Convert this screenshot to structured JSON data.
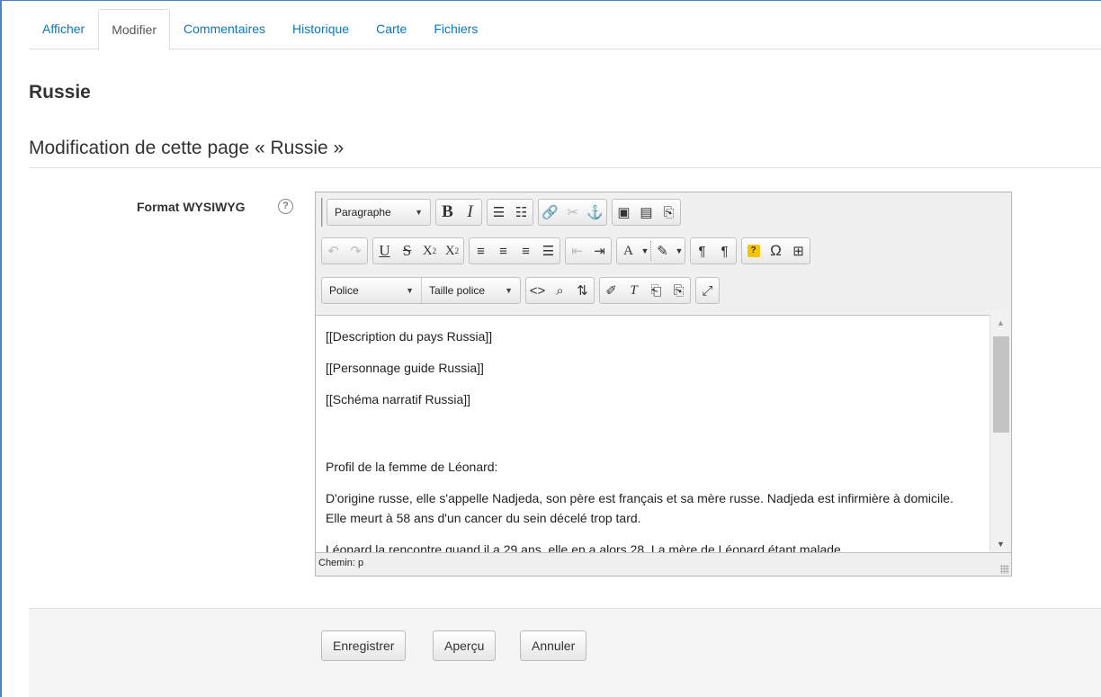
{
  "tabs": [
    {
      "label": "Afficher"
    },
    {
      "label": "Modifier",
      "active": true
    },
    {
      "label": "Commentaires"
    },
    {
      "label": "Historique"
    },
    {
      "label": "Carte"
    },
    {
      "label": "Fichiers"
    }
  ],
  "page_title": "Russie",
  "section_title": "Modification de cette page « Russie »",
  "field_label": "Format WYSIWYG",
  "help_icon_glyph": "?",
  "editor": {
    "paragraph_format": "Paragraphe",
    "font_family": "Police",
    "font_size": "Taille police",
    "content": [
      "[[Description du pays Russia]]",
      "[[Personnage guide Russia]]",
      "[[Schéma narratif Russia]]",
      "Profil de la femme de Léonard:",
      "D'origine russe, elle s'appelle Nadjeda, son père est français et sa mère russe. Nadjeda est infirmière à domicile. Elle meurt à 58 ans d'un cancer du sein décelé trop tard.",
      "Léonard la rencontre quand il a 29 ans, elle en a alors 28. La mère de Léonard étant malade"
    ],
    "status_path": "Chemin: p"
  },
  "buttons": {
    "save": "Enregistrer",
    "preview": "Aperçu",
    "cancel": "Annuler"
  },
  "colors": {
    "link": "#0a78b8",
    "frame": "#4a86c5",
    "footer_bg": "#f5f5f5"
  }
}
